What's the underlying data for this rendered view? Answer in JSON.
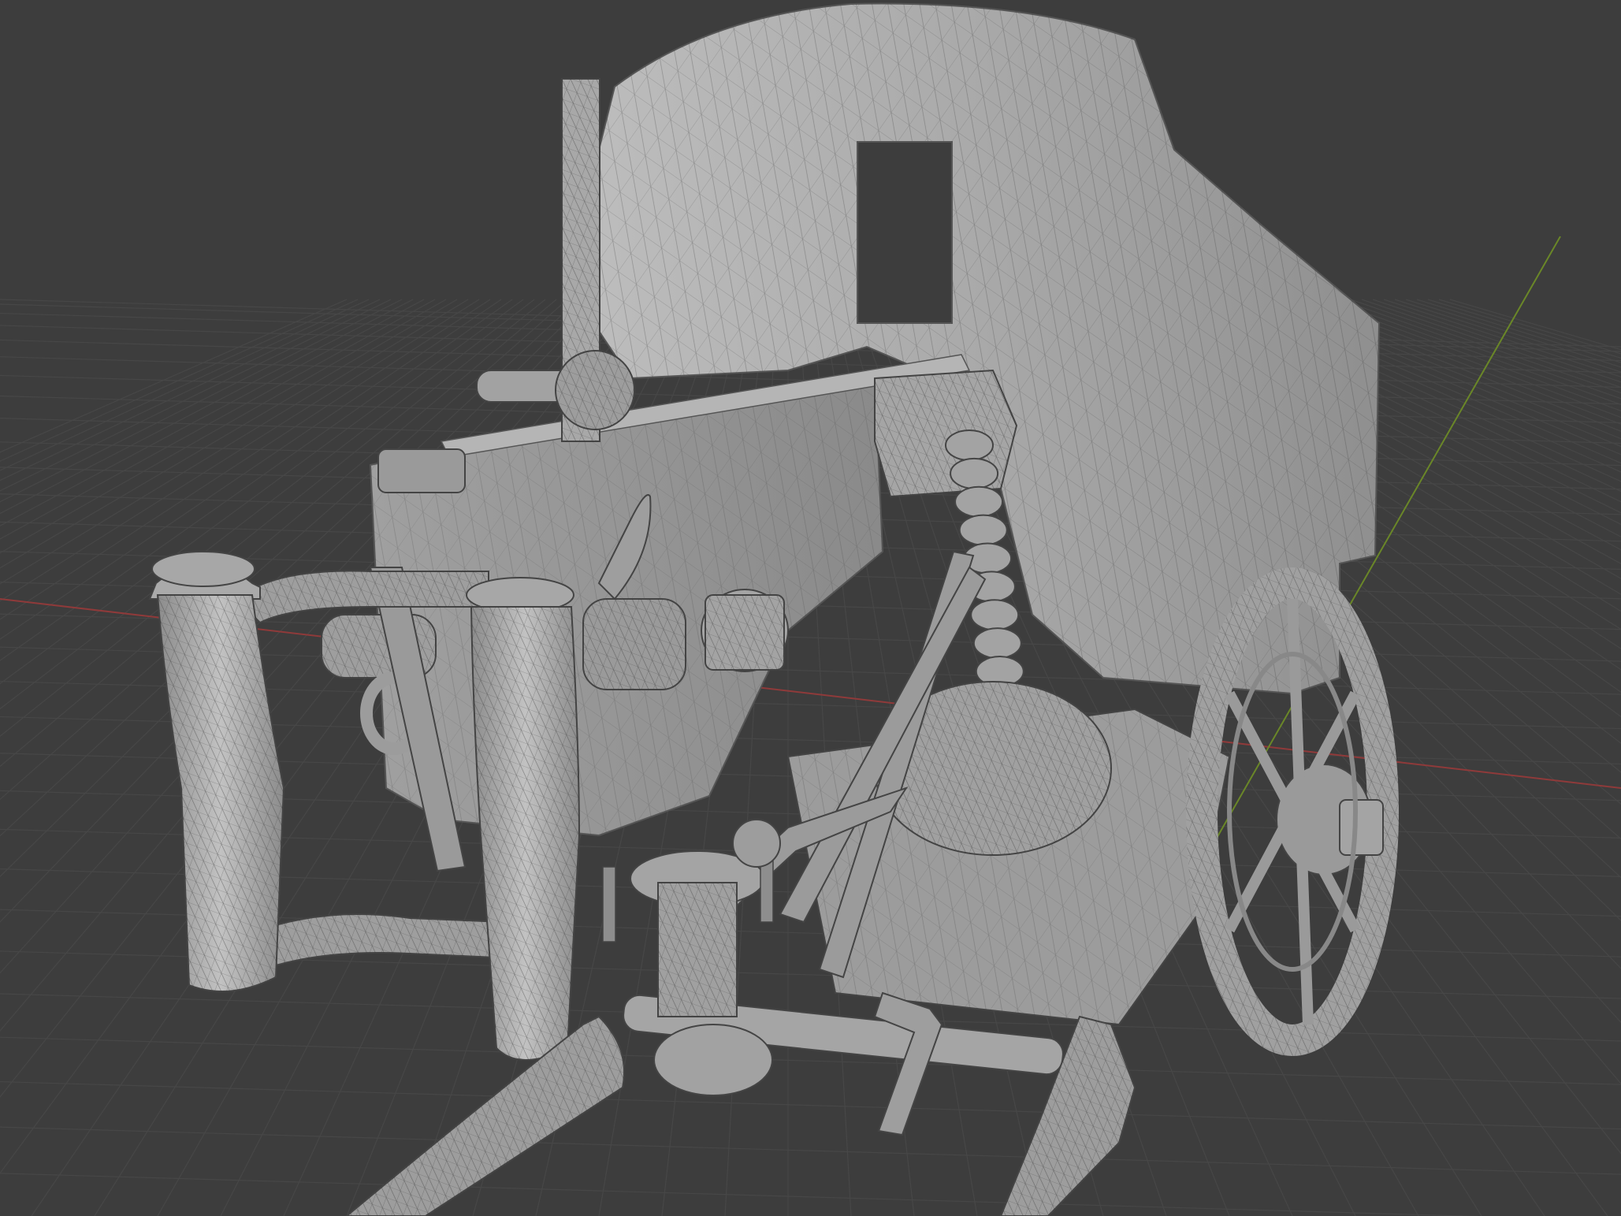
{
  "viewport": {
    "background": "#3d3d3d",
    "grid_color": "#4a4a4a",
    "x_axis_color": "#9a3b3b",
    "y_axis_color": "#6e8a2a",
    "mesh_fill": "#a6a6a6",
    "mesh_light": "#c8c8c8",
    "mesh_dark": "#7e7e7e",
    "wire_color": "#2f2f2f"
  },
  "objects": [
    "gun-shield",
    "gun-body",
    "rear-sight",
    "ammunition-belt",
    "spade-grips",
    "wheel",
    "carriage",
    "trail"
  ]
}
